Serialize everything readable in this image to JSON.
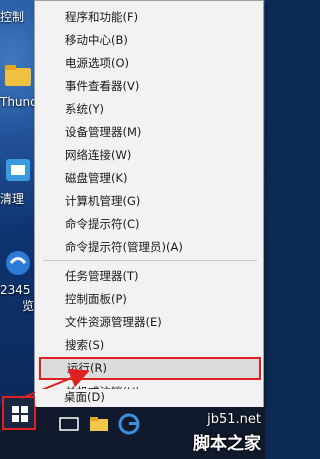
{
  "desktop": {
    "icons": [
      {
        "name": "控制",
        "icon": "control-panel-icon"
      },
      {
        "name": "Thund",
        "icon": "thunder-folder-icon"
      },
      {
        "name": "清理",
        "icon": "cleaner-icon"
      },
      {
        "name": "2345",
        "icon": "browser-2345-icon"
      },
      {
        "name": "览",
        "icon": ""
      }
    ]
  },
  "menu": {
    "items": [
      "程序和功能(F)",
      "移动中心(B)",
      "电源选项(O)",
      "事件查看器(V)",
      "系统(Y)",
      "设备管理器(M)",
      "网络连接(W)",
      "磁盘管理(K)",
      "计算机管理(G)",
      "命令提示符(C)",
      "命令提示符(管理员)(A)",
      "任务管理器(T)",
      "控制面板(P)",
      "文件资源管理器(E)",
      "搜索(S)",
      "运行(R)",
      "关机或注销(U)",
      "桌面(D)"
    ],
    "highlighted": "运行(R)"
  },
  "taskbar": {
    "start_icon": "windows-logo-icon",
    "pinned": [
      "task-view-icon",
      "file-explorer-icon",
      "edge-icon"
    ]
  },
  "watermark": {
    "site": "jb51.net",
    "brand": "脚本之家"
  },
  "colors": {
    "highlight_border": "#e02020",
    "menu_bg": "#f2f2f2",
    "arrow": "#e02020"
  }
}
